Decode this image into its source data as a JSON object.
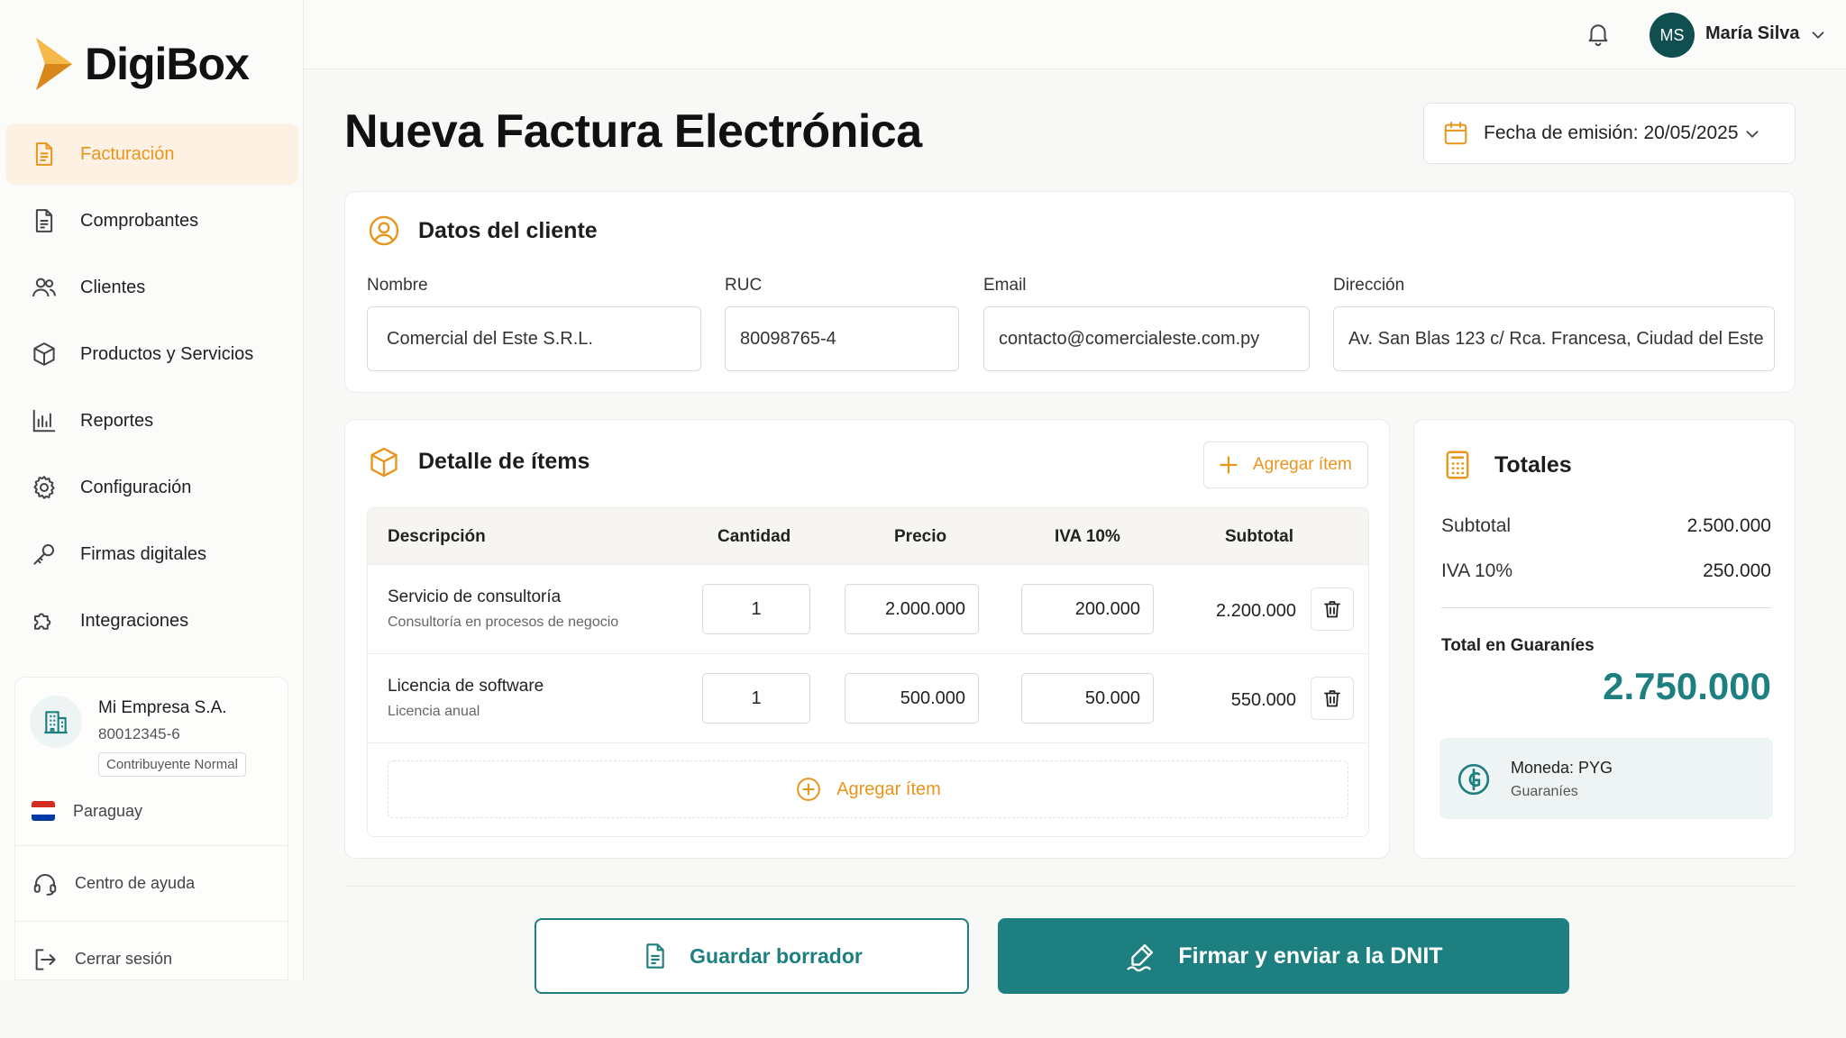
{
  "brand": {
    "name": "DigiBox",
    "accent": "#e8951c",
    "teal": "#1e7f80"
  },
  "sidebar": {
    "items": [
      {
        "label": "Facturación",
        "icon": "document-icon",
        "active": true
      },
      {
        "label": "Comprobantes",
        "icon": "receipt-icon"
      },
      {
        "label": "Clientes",
        "icon": "users-icon"
      },
      {
        "label": "Productos y Servicios",
        "icon": "box-icon"
      },
      {
        "label": "Reportes",
        "icon": "bar-chart-icon"
      },
      {
        "label": "Configuración",
        "icon": "gear-icon"
      },
      {
        "label": "Firmas digitales",
        "icon": "key-icon"
      },
      {
        "label": "Integraciones",
        "icon": "puzzle-icon"
      }
    ],
    "company": {
      "name": "Mi Empresa S.A.",
      "ruc": "80012345-6",
      "badge": "Contribuyente Normal"
    },
    "country": "Paraguay",
    "help": "Centro de ayuda",
    "logout": "Cerrar sesión"
  },
  "header": {
    "user_initials": "MS",
    "user_name": "María Silva"
  },
  "page": {
    "title": "Nueva Factura Electrónica",
    "date_label": "Fecha de emisión:",
    "date_value": "20/05/2025"
  },
  "client": {
    "title": "Datos del cliente",
    "fields": [
      {
        "label": "Nombre",
        "value": "Comercial del Este S.R.L."
      },
      {
        "label": "RUC",
        "value": "80098765-4"
      },
      {
        "label": "Email",
        "value": "contacto@comercialeste.com.py"
      },
      {
        "label": "Dirección",
        "value": "Av. San Blas 123 c/ Rca. Francesa, Ciudad del Este"
      }
    ]
  },
  "items": {
    "title": "Detalle de ítems",
    "add_label": "Agregar ítem",
    "columns": [
      "Descripción",
      "Cantidad",
      "Precio",
      "IVA 10%",
      "Subtotal"
    ],
    "rows": [
      {
        "desc": "Servicio de consultoría",
        "sub": "Consultoría en procesos de negocio",
        "qty": "1",
        "price": "2.000.000",
        "iva": "200.000",
        "subtotal": "2.200.000"
      },
      {
        "desc": "Licencia de software",
        "sub": "Licencia anual",
        "qty": "1",
        "price": "500.000",
        "iva": "50.000",
        "subtotal": "550.000"
      }
    ],
    "add_row_label": "Agregar ítem"
  },
  "totals": {
    "title": "Totales",
    "subtotal_label": "Subtotal",
    "subtotal_value": "2.500.000",
    "iva_label": "IVA 10%",
    "iva_value": "250.000",
    "grand_label": "Total en Guaraníes",
    "grand_value": "2.750.000",
    "currency_main": "Moneda: PYG",
    "currency_sub": "Guaraníes"
  },
  "actions": {
    "draft": "Guardar borrador",
    "sign": "Firmar y enviar a la DNIT"
  }
}
